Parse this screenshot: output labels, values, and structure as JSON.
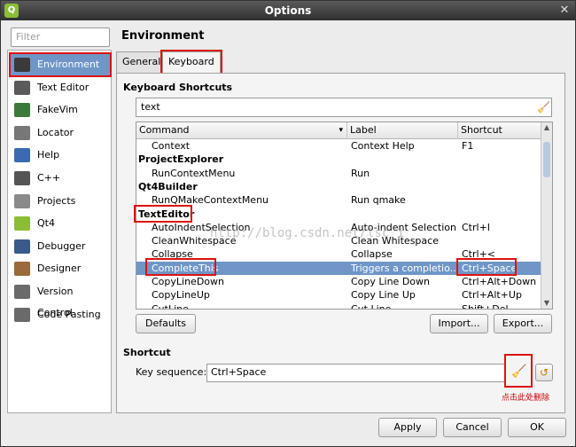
{
  "window": {
    "title": "Options"
  },
  "filter": {
    "placeholder": "Filter"
  },
  "categories": [
    {
      "label": "Environment",
      "icon": "monitor-icon",
      "color": "#3a3a3a"
    },
    {
      "label": "Text Editor",
      "icon": "text-editor-icon",
      "color": "#5a5a5a"
    },
    {
      "label": "FakeVim",
      "icon": "fakevim-icon",
      "color": "#3c7a3c"
    },
    {
      "label": "Locator",
      "icon": "locator-icon",
      "color": "#777777"
    },
    {
      "label": "Help",
      "icon": "help-icon",
      "color": "#3a6ab0"
    },
    {
      "label": "C++",
      "icon": "cpp-icon",
      "color": "#555555"
    },
    {
      "label": "Projects",
      "icon": "projects-icon",
      "color": "#8a8a8a"
    },
    {
      "label": "Qt4",
      "icon": "qt4-icon",
      "color": "#8bbd3a"
    },
    {
      "label": "Debugger",
      "icon": "debugger-icon",
      "color": "#3a5a8a"
    },
    {
      "label": "Designer",
      "icon": "designer-icon",
      "color": "#9a6a3a"
    },
    {
      "label": "Version Control",
      "icon": "version-control-icon",
      "color": "#6a6a6a"
    },
    {
      "label": "Code Pasting",
      "icon": "code-pasting-icon",
      "color": "#6a6a6a"
    }
  ],
  "heading": "Environment",
  "tabs": [
    "General",
    "Keyboard"
  ],
  "shortcuts_section": "Keyboard Shortcuts",
  "search_value": "text",
  "table": {
    "headers": [
      "Command",
      "Label",
      "Shortcut"
    ],
    "rows": [
      {
        "command": "Context",
        "label": "Context Help",
        "shortcut": "F1",
        "kind": "item"
      },
      {
        "command": "ProjectExplorer",
        "label": "",
        "shortcut": "",
        "kind": "category"
      },
      {
        "command": "RunContextMenu",
        "label": "Run",
        "shortcut": "",
        "kind": "item"
      },
      {
        "command": "Qt4Builder",
        "label": "",
        "shortcut": "",
        "kind": "category"
      },
      {
        "command": "RunQMakeContextMenu",
        "label": "Run qmake",
        "shortcut": "",
        "kind": "item"
      },
      {
        "command": "TextEditor",
        "label": "",
        "shortcut": "",
        "kind": "category"
      },
      {
        "command": "AutoIndentSelection",
        "label": "Auto-indent Selection",
        "shortcut": "Ctrl+I",
        "kind": "item"
      },
      {
        "command": "CleanWhitespace",
        "label": "Clean Whitespace",
        "shortcut": "",
        "kind": "item"
      },
      {
        "command": "Collapse",
        "label": "Collapse",
        "shortcut": "Ctrl+<",
        "kind": "item"
      },
      {
        "command": "CompleteThis",
        "label": "Triggers a completio...",
        "shortcut": "Ctrl+Space",
        "kind": "item"
      },
      {
        "command": "CopyLineDown",
        "label": "Copy Line Down",
        "shortcut": "Ctrl+Alt+Down",
        "kind": "item"
      },
      {
        "command": "CopyLineUp",
        "label": "Copy Line Up",
        "shortcut": "Ctrl+Alt+Up",
        "kind": "item"
      },
      {
        "command": "CutLine",
        "label": "Cut Line",
        "shortcut": "Shift+Del",
        "kind": "item"
      }
    ]
  },
  "buttons": {
    "defaults": "Defaults",
    "import": "Import...",
    "export": "Export...",
    "apply": "Apply",
    "cancel": "Cancel",
    "ok": "OK"
  },
  "shortcut_section": "Shortcut",
  "key_sequence": {
    "label": "Key sequence:",
    "value": "Ctrl+Space"
  },
  "annotation_note": "点击此处删除",
  "watermark": "http://blog.csdn.net/lsc_1"
}
